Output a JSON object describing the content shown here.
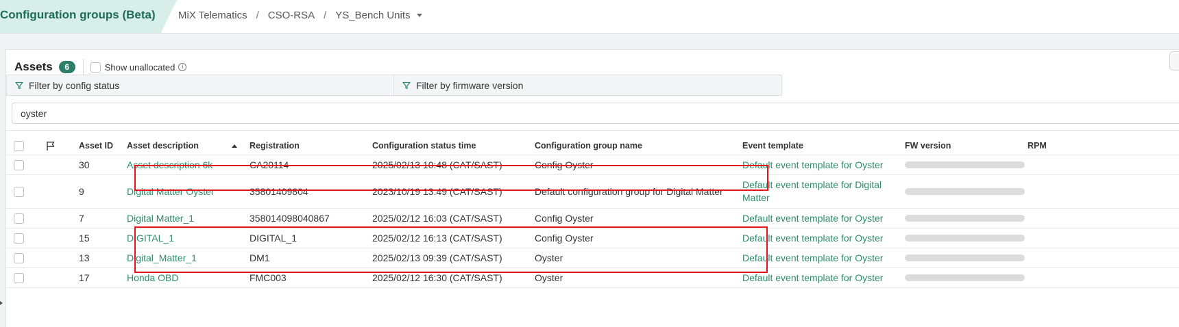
{
  "header": {
    "title": "Configuration groups (Beta)",
    "breadcrumbs": [
      "MiX Telematics",
      "CSO-RSA",
      "YS_Bench Units"
    ],
    "separator": "/"
  },
  "assets": {
    "title": "Assets",
    "count": "6",
    "show_unallocated_label": "Show unallocated",
    "show_unallocated_checked": false
  },
  "filters": {
    "config_status": "Filter by config status",
    "firmware_version": "Filter by firmware version"
  },
  "search": {
    "value": "oyster"
  },
  "table": {
    "columns": {
      "asset_id": "Asset ID",
      "asset_description": "Asset description",
      "registration": "Registration",
      "config_status_time": "Configuration status time",
      "config_group_name": "Configuration group name",
      "event_template": "Event template",
      "fw_version": "FW version",
      "rpm": "RPM"
    },
    "sort": {
      "column": "asset_description",
      "direction": "ascending"
    },
    "rows": [
      {
        "asset_id": "30",
        "description": "Asset description 6k",
        "registration": "CA20114",
        "status_time": "2025/02/13 10:48 (CAT/SAST)",
        "group": "Config Oyster",
        "event_template": "Default event template for Oyster",
        "highlighted": true
      },
      {
        "asset_id": "9",
        "description": "Digital Matter Oyster",
        "registration": "35801409804",
        "status_time": "2023/10/19 13:49 (CAT/SAST)",
        "group": "Default configuration group for Digital Matter",
        "event_template": "Default event template for Digital Matter",
        "highlighted": false
      },
      {
        "asset_id": "7",
        "description": "Digital Matter_1",
        "registration": "358014098040867",
        "status_time": "2025/02/12 16:03 (CAT/SAST)",
        "group": "Config Oyster",
        "event_template": "Default event template for Oyster",
        "highlighted": true
      },
      {
        "asset_id": "15",
        "description": "DIGITAL_1",
        "registration": "DIGITAL_1",
        "status_time": "2025/02/12 16:13 (CAT/SAST)",
        "group": "Config Oyster",
        "event_template": "Default event template for Oyster",
        "highlighted": true
      },
      {
        "asset_id": "13",
        "description": "Digital_Matter_1",
        "registration": "DM1",
        "status_time": "2025/02/13 09:39 (CAT/SAST)",
        "group": "Oyster",
        "event_template": "Default event template for Oyster",
        "highlighted": false
      },
      {
        "asset_id": "17",
        "description": "Honda OBD",
        "registration": "FMC003",
        "status_time": "2025/02/12 16:30 (CAT/SAST)",
        "group": "Oyster",
        "event_template": "Default event template for Oyster",
        "highlighted": false
      }
    ]
  },
  "colors": {
    "brand": "#1e6e58",
    "link": "#2e8b6e",
    "badge": "#2e7d68",
    "highlight_box": "#e8141b"
  },
  "icons": [
    "chevron-down-icon",
    "info-icon",
    "filter-icon",
    "flag-icon",
    "sort-ascending-icon"
  ]
}
